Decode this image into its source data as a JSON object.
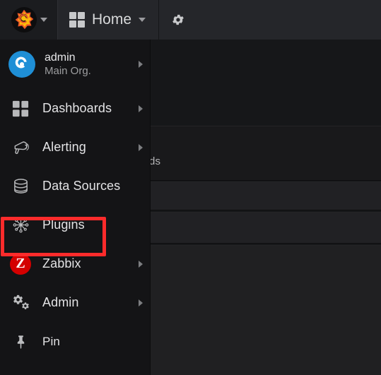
{
  "app": {
    "background_color": "#161719",
    "accent_color": "#fd2b2b",
    "panel_color": "#212124"
  },
  "topbar": {
    "brand": {
      "name": "grafana-logo",
      "caret": "chevron-down-icon"
    },
    "home": {
      "label": "Home",
      "icon": "grid-icon",
      "caret": "caret-down-icon"
    },
    "settings": {
      "icon": "gear-icon",
      "label": ""
    }
  },
  "sidemenu": {
    "user": {
      "name": "admin",
      "org": "Main Org.",
      "avatar_color": "#1f8fd6",
      "has_submenu": true
    },
    "items": [
      {
        "label": "Dashboards",
        "icon": "dashboards-icon",
        "has_submenu": true,
        "highlighted": false
      },
      {
        "label": "Alerting",
        "icon": "bullhorn-icon",
        "has_submenu": true,
        "highlighted": false
      },
      {
        "label": "Data Sources",
        "icon": "database-icon",
        "has_submenu": false,
        "highlighted": false
      },
      {
        "label": "Plugins",
        "icon": "plugins-icon",
        "has_submenu": false,
        "highlighted": true
      },
      {
        "label": "Zabbix",
        "icon": "zabbix-icon",
        "has_submenu": true,
        "highlighted": false
      },
      {
        "label": "Admin",
        "icon": "cogs-icon",
        "has_submenu": true,
        "highlighted": false
      },
      {
        "label": "Pin",
        "icon": "pin-icon",
        "has_submenu": false,
        "highlighted": false
      }
    ]
  },
  "background_page": {
    "partial_text": "ds",
    "faint_text": ""
  }
}
